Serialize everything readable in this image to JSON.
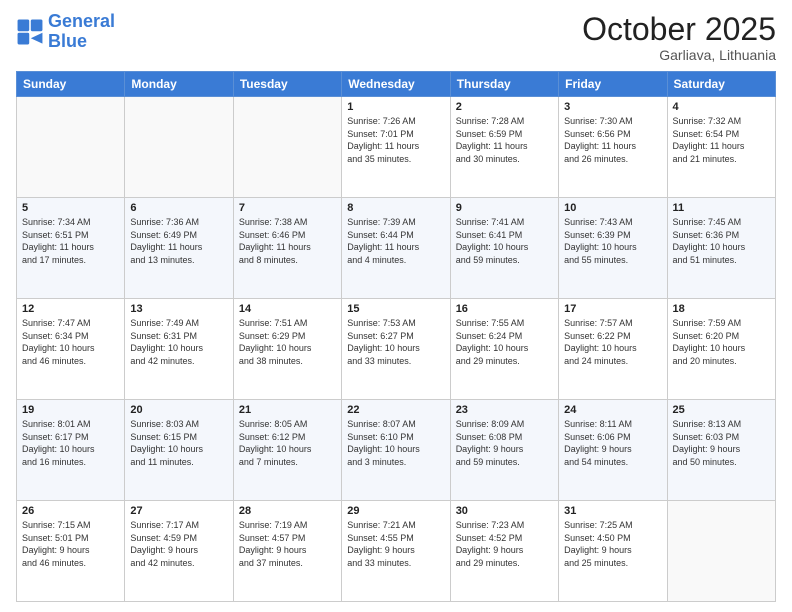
{
  "logo": {
    "text_general": "General",
    "text_blue": "Blue"
  },
  "title": "October 2025",
  "subtitle": "Garliava, Lithuania",
  "days_of_week": [
    "Sunday",
    "Monday",
    "Tuesday",
    "Wednesday",
    "Thursday",
    "Friday",
    "Saturday"
  ],
  "weeks": [
    [
      {
        "day": "",
        "info": ""
      },
      {
        "day": "",
        "info": ""
      },
      {
        "day": "",
        "info": ""
      },
      {
        "day": "1",
        "info": "Sunrise: 7:26 AM\nSunset: 7:01 PM\nDaylight: 11 hours\nand 35 minutes."
      },
      {
        "day": "2",
        "info": "Sunrise: 7:28 AM\nSunset: 6:59 PM\nDaylight: 11 hours\nand 30 minutes."
      },
      {
        "day": "3",
        "info": "Sunrise: 7:30 AM\nSunset: 6:56 PM\nDaylight: 11 hours\nand 26 minutes."
      },
      {
        "day": "4",
        "info": "Sunrise: 7:32 AM\nSunset: 6:54 PM\nDaylight: 11 hours\nand 21 minutes."
      }
    ],
    [
      {
        "day": "5",
        "info": "Sunrise: 7:34 AM\nSunset: 6:51 PM\nDaylight: 11 hours\nand 17 minutes."
      },
      {
        "day": "6",
        "info": "Sunrise: 7:36 AM\nSunset: 6:49 PM\nDaylight: 11 hours\nand 13 minutes."
      },
      {
        "day": "7",
        "info": "Sunrise: 7:38 AM\nSunset: 6:46 PM\nDaylight: 11 hours\nand 8 minutes."
      },
      {
        "day": "8",
        "info": "Sunrise: 7:39 AM\nSunset: 6:44 PM\nDaylight: 11 hours\nand 4 minutes."
      },
      {
        "day": "9",
        "info": "Sunrise: 7:41 AM\nSunset: 6:41 PM\nDaylight: 10 hours\nand 59 minutes."
      },
      {
        "day": "10",
        "info": "Sunrise: 7:43 AM\nSunset: 6:39 PM\nDaylight: 10 hours\nand 55 minutes."
      },
      {
        "day": "11",
        "info": "Sunrise: 7:45 AM\nSunset: 6:36 PM\nDaylight: 10 hours\nand 51 minutes."
      }
    ],
    [
      {
        "day": "12",
        "info": "Sunrise: 7:47 AM\nSunset: 6:34 PM\nDaylight: 10 hours\nand 46 minutes."
      },
      {
        "day": "13",
        "info": "Sunrise: 7:49 AM\nSunset: 6:31 PM\nDaylight: 10 hours\nand 42 minutes."
      },
      {
        "day": "14",
        "info": "Sunrise: 7:51 AM\nSunset: 6:29 PM\nDaylight: 10 hours\nand 38 minutes."
      },
      {
        "day": "15",
        "info": "Sunrise: 7:53 AM\nSunset: 6:27 PM\nDaylight: 10 hours\nand 33 minutes."
      },
      {
        "day": "16",
        "info": "Sunrise: 7:55 AM\nSunset: 6:24 PM\nDaylight: 10 hours\nand 29 minutes."
      },
      {
        "day": "17",
        "info": "Sunrise: 7:57 AM\nSunset: 6:22 PM\nDaylight: 10 hours\nand 24 minutes."
      },
      {
        "day": "18",
        "info": "Sunrise: 7:59 AM\nSunset: 6:20 PM\nDaylight: 10 hours\nand 20 minutes."
      }
    ],
    [
      {
        "day": "19",
        "info": "Sunrise: 8:01 AM\nSunset: 6:17 PM\nDaylight: 10 hours\nand 16 minutes."
      },
      {
        "day": "20",
        "info": "Sunrise: 8:03 AM\nSunset: 6:15 PM\nDaylight: 10 hours\nand 11 minutes."
      },
      {
        "day": "21",
        "info": "Sunrise: 8:05 AM\nSunset: 6:12 PM\nDaylight: 10 hours\nand 7 minutes."
      },
      {
        "day": "22",
        "info": "Sunrise: 8:07 AM\nSunset: 6:10 PM\nDaylight: 10 hours\nand 3 minutes."
      },
      {
        "day": "23",
        "info": "Sunrise: 8:09 AM\nSunset: 6:08 PM\nDaylight: 9 hours\nand 59 minutes."
      },
      {
        "day": "24",
        "info": "Sunrise: 8:11 AM\nSunset: 6:06 PM\nDaylight: 9 hours\nand 54 minutes."
      },
      {
        "day": "25",
        "info": "Sunrise: 8:13 AM\nSunset: 6:03 PM\nDaylight: 9 hours\nand 50 minutes."
      }
    ],
    [
      {
        "day": "26",
        "info": "Sunrise: 7:15 AM\nSunset: 5:01 PM\nDaylight: 9 hours\nand 46 minutes."
      },
      {
        "day": "27",
        "info": "Sunrise: 7:17 AM\nSunset: 4:59 PM\nDaylight: 9 hours\nand 42 minutes."
      },
      {
        "day": "28",
        "info": "Sunrise: 7:19 AM\nSunset: 4:57 PM\nDaylight: 9 hours\nand 37 minutes."
      },
      {
        "day": "29",
        "info": "Sunrise: 7:21 AM\nSunset: 4:55 PM\nDaylight: 9 hours\nand 33 minutes."
      },
      {
        "day": "30",
        "info": "Sunrise: 7:23 AM\nSunset: 4:52 PM\nDaylight: 9 hours\nand 29 minutes."
      },
      {
        "day": "31",
        "info": "Sunrise: 7:25 AM\nSunset: 4:50 PM\nDaylight: 9 hours\nand 25 minutes."
      },
      {
        "day": "",
        "info": ""
      }
    ]
  ]
}
